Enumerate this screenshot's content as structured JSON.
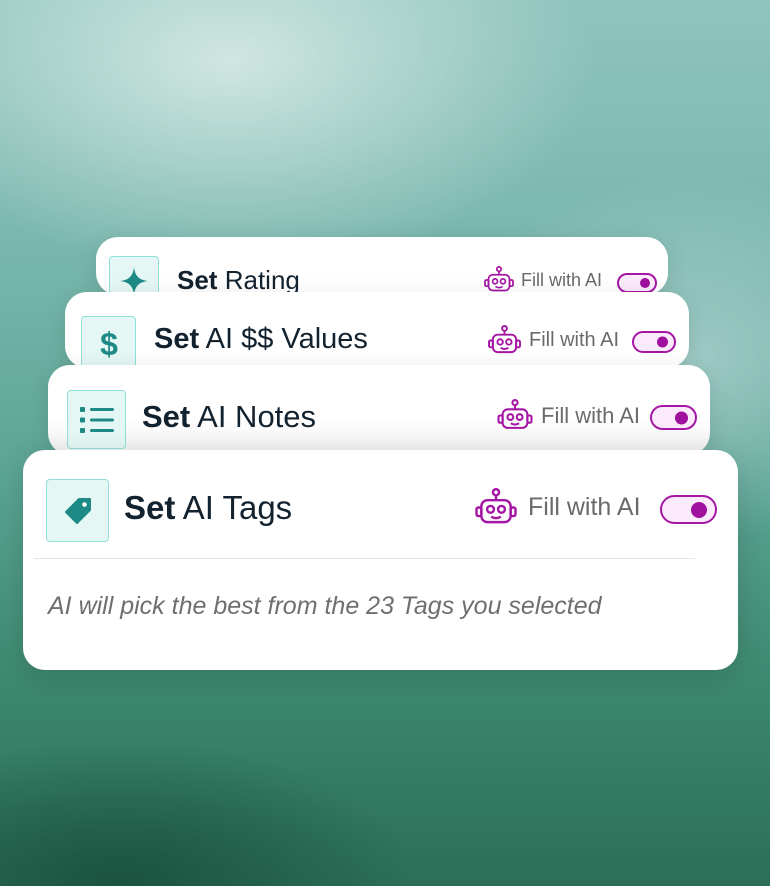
{
  "cards": {
    "rating": {
      "set_label": "Set",
      "rest_label": "Rating",
      "icon": "sparkle-icon",
      "fill_label": "Fill with AI",
      "toggle_on": true
    },
    "values": {
      "set_label": "Set",
      "rest_label": "AI $$ Values",
      "icon": "dollar-icon",
      "fill_label": "Fill with AI",
      "toggle_on": true
    },
    "notes": {
      "set_label": "Set",
      "rest_label": "AI Notes",
      "icon": "list-icon",
      "fill_label": "Fill with AI",
      "toggle_on": true
    },
    "tags": {
      "set_label": "Set",
      "rest_label": "AI Tags",
      "icon": "tag-icon",
      "fill_label": "Fill with AI",
      "toggle_on": true,
      "hint": "AI will pick the best from the 23 Tags you selected"
    }
  },
  "colors": {
    "accent": "#a516a5",
    "teal": "#1d8a85",
    "title": "#13222f"
  }
}
